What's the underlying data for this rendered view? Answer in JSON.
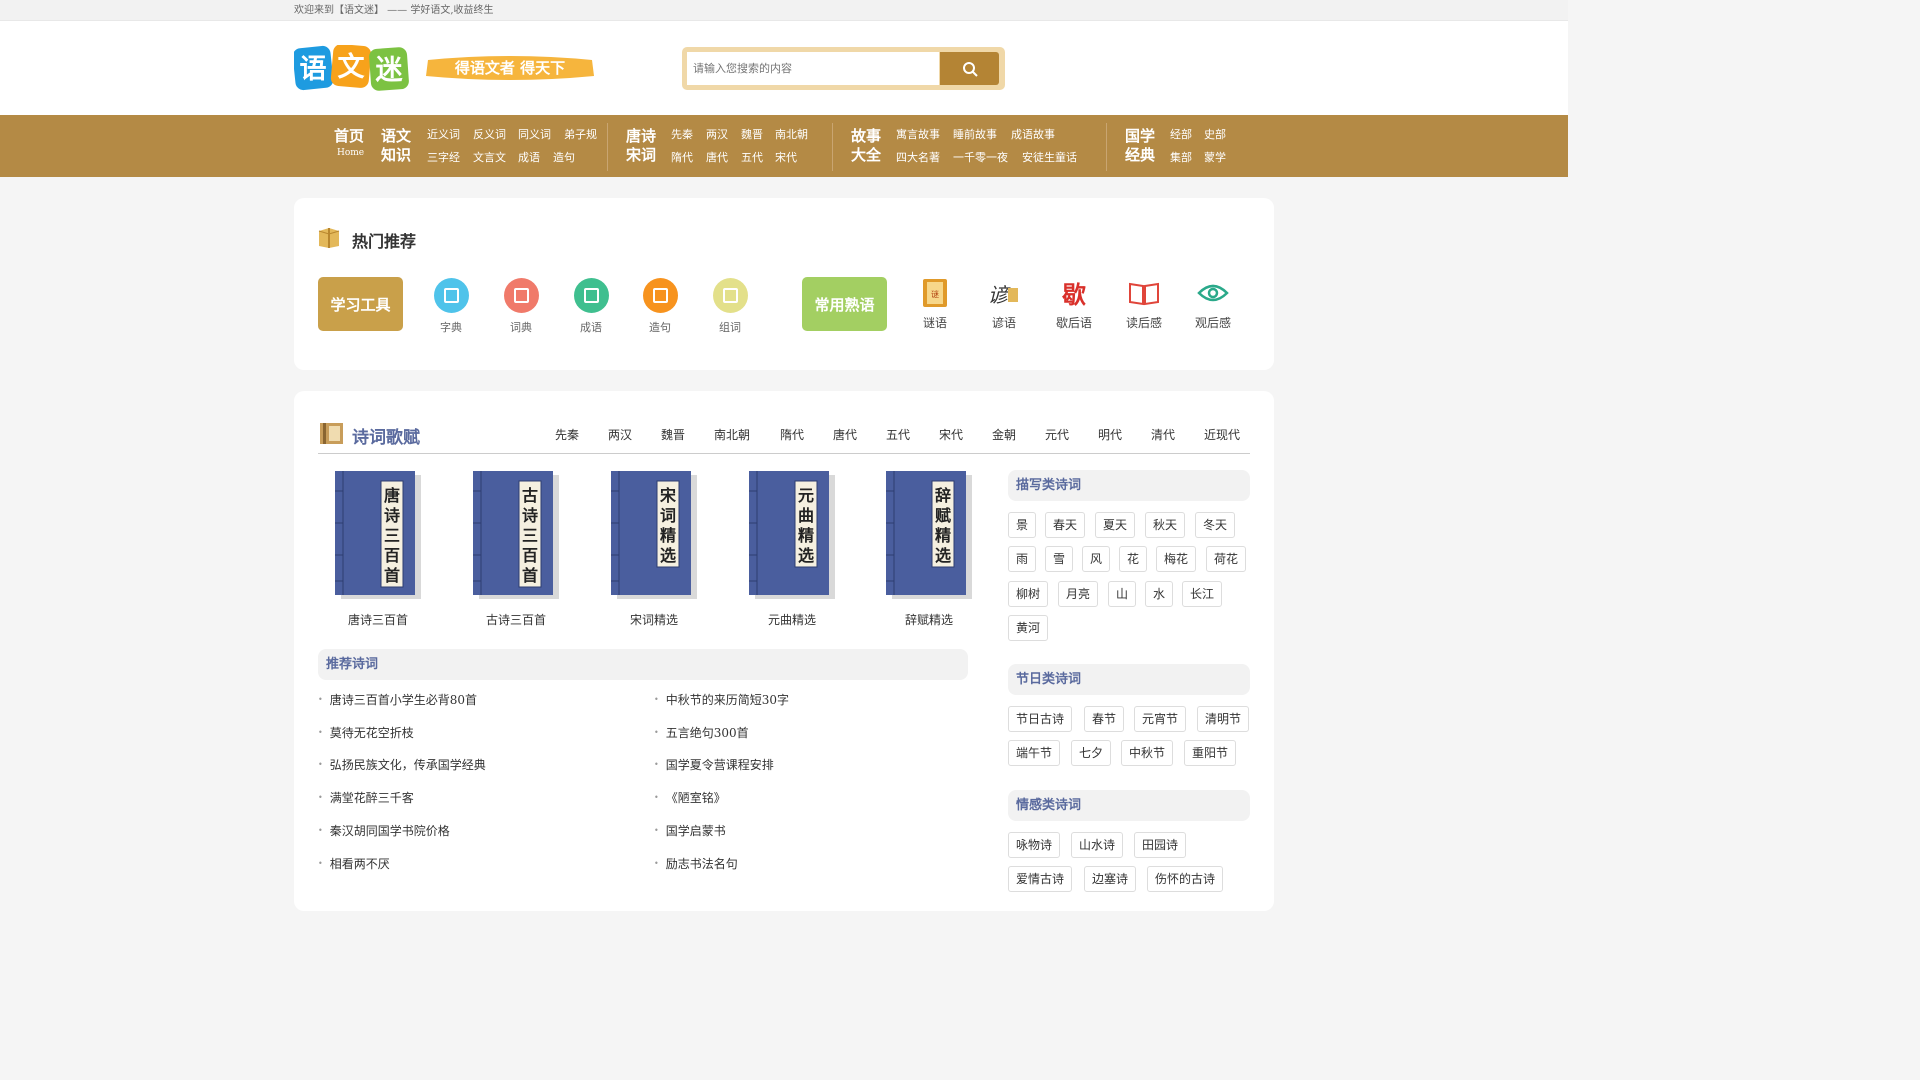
{
  "topbar": {
    "welcome": "欢迎来到【语文迷】 —— 学好语文,收益终生"
  },
  "header": {
    "logo_text": "语文迷",
    "slogan": "得语文者 得天下",
    "search_placeholder": "请输入您搜索的内容"
  },
  "nav": {
    "home": "首页",
    "home_en": "Home",
    "groups": [
      {
        "title1": "语文",
        "title2": "知识",
        "row1": [
          "近义词",
          "反义词",
          "同义词",
          "弟子规"
        ],
        "row2": [
          "三字经",
          "文言文",
          "成语",
          "造句"
        ]
      },
      {
        "title1": "唐诗",
        "title2": "宋词",
        "row1": [
          "先秦",
          "两汉",
          "魏晋",
          "南北朝"
        ],
        "row2": [
          "隋代",
          "唐代",
          "五代",
          "宋代"
        ]
      },
      {
        "title1": "故事",
        "title2": "大全",
        "row1": [
          "寓言故事",
          "睡前故事",
          "成语故事"
        ],
        "row2": [
          "四大名著",
          "一千零一夜",
          "安徒生童话"
        ]
      },
      {
        "title1": "国学",
        "title2": "经典",
        "row1": [
          "经部",
          "史部"
        ],
        "row2": [
          "集部",
          "蒙学"
        ]
      }
    ]
  },
  "hot": {
    "title": "热门推荐",
    "tools_button": "学习工具",
    "tools": [
      {
        "label": "字典",
        "color": "#4fc3ea"
      },
      {
        "label": "词典",
        "color": "#f07a6a"
      },
      {
        "label": "成语",
        "color": "#3fbf8f"
      },
      {
        "label": "造句",
        "color": "#f7931e"
      },
      {
        "label": "组词",
        "color": "#e3e08a"
      }
    ],
    "phrases_button": "常用熟语",
    "phrases": [
      {
        "label": "谜语",
        "icon": "riddle-book-icon"
      },
      {
        "label": "谚语",
        "icon": "proverb-icon"
      },
      {
        "label": "歇后语",
        "icon": "xiehouyu-icon"
      },
      {
        "label": "读后感",
        "icon": "open-book-icon"
      },
      {
        "label": "观后感",
        "icon": "eye-icon"
      }
    ]
  },
  "poetry": {
    "title": "诗词歌赋",
    "dynasties": [
      "先秦",
      "两汉",
      "魏晋",
      "南北朝",
      "隋代",
      "唐代",
      "五代",
      "宋代",
      "金朝",
      "元代",
      "明代",
      "清代",
      "近现代"
    ],
    "books": [
      {
        "cover": "唐诗三百首",
        "name": "唐诗三百首"
      },
      {
        "cover": "古诗三百首",
        "name": "古诗三百首"
      },
      {
        "cover": "宋词精选",
        "name": "宋词精选"
      },
      {
        "cover": "元曲精选",
        "name": "元曲精选"
      },
      {
        "cover": "辞赋精选",
        "name": "辞赋精选"
      }
    ],
    "recommend_title": "推荐诗词",
    "recommend_left": [
      "唐诗三百首小学生必背80首",
      "莫待无花空折枝",
      "弘扬民族文化，传承国学经典",
      "满堂花醉三千客",
      "秦汉胡同国学书院价格",
      "相看两不厌"
    ],
    "recommend_right": [
      "中秋节的来历简短30字",
      "五言绝句300首",
      "国学夏令营课程安排",
      "《陋室铭》",
      "国学启蒙书",
      "励志书法名句"
    ],
    "describe_title": "描写类诗词",
    "describe_tags": [
      [
        "景",
        "春天",
        "夏天",
        "秋天",
        "冬天"
      ],
      [
        "雨",
        "雪",
        "风",
        "花",
        "梅花",
        "荷花"
      ],
      [
        "柳树",
        "月亮",
        "山",
        "水",
        "长江"
      ],
      [
        "黄河"
      ]
    ],
    "festival_title": "节日类诗词",
    "festival_tags": [
      [
        "节日古诗",
        "春节",
        "元宵节",
        "清明节"
      ],
      [
        "端午节",
        "七夕",
        "中秋节",
        "重阳节"
      ]
    ],
    "emotion_title": "情感类诗词",
    "emotion_tags": [
      [
        "咏物诗",
        "山水诗",
        "田园诗"
      ],
      [
        "爱情古诗",
        "边塞诗",
        "伤怀的古诗"
      ]
    ]
  },
  "colors": {
    "brand": "#b48a45",
    "accent_green": "#a3cf62",
    "accent_gold": "#c9a04a",
    "title_blue": "#5a6a9e"
  }
}
